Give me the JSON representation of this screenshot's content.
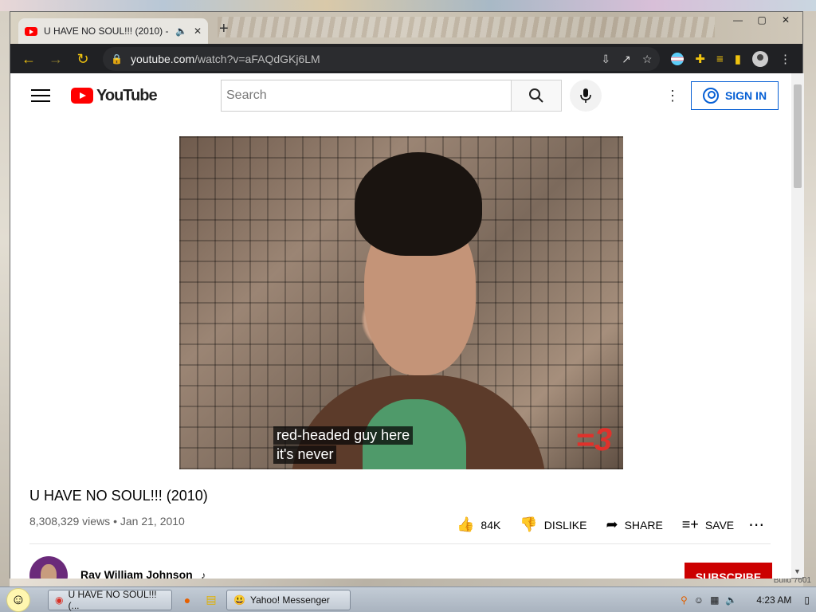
{
  "browser": {
    "tab": {
      "title": "U HAVE NO SOUL!!! (2010) -",
      "audio_icon": "speaker-icon",
      "close": "✕"
    },
    "new_tab": "+",
    "window_controls": [
      "—",
      "▢",
      "✕"
    ],
    "url": {
      "host": "youtube.com",
      "path": "/watch?v=aFAQdGKj6LM"
    }
  },
  "youtube": {
    "logo_text": "YouTube",
    "search_placeholder": "Search",
    "sign_in_label": "SIGN IN",
    "video": {
      "caption_lines": [
        "red-headed guy here",
        "it's never"
      ],
      "badge": "=3"
    },
    "title": "U HAVE NO SOUL!!! (2010)",
    "views": "8,308,329 views",
    "date": "Jan 21, 2010",
    "actions": [
      {
        "icon": "thumb-up-icon",
        "label": "84K"
      },
      {
        "icon": "thumb-down-icon",
        "label": "DISLIKE"
      },
      {
        "icon": "share-icon",
        "label": "SHARE"
      },
      {
        "icon": "save-playlist-icon",
        "label": "SAVE"
      }
    ],
    "channel": {
      "name": "Ray William Johnson"
    },
    "subscribe_label": "SUBSCRIBE"
  },
  "taskbar": {
    "chrome_task": "U HAVE NO SOUL!!! (...",
    "messenger_task": "Yahoo! Messenger",
    "clock": "4:23 AM"
  },
  "desktop": {
    "build_label": "Build 7601"
  },
  "colors": {
    "yt_red": "#ff0000",
    "link_blue": "#065fd4",
    "subscribe_red": "#cc0000",
    "chrome_accent": "#f1c40f"
  }
}
